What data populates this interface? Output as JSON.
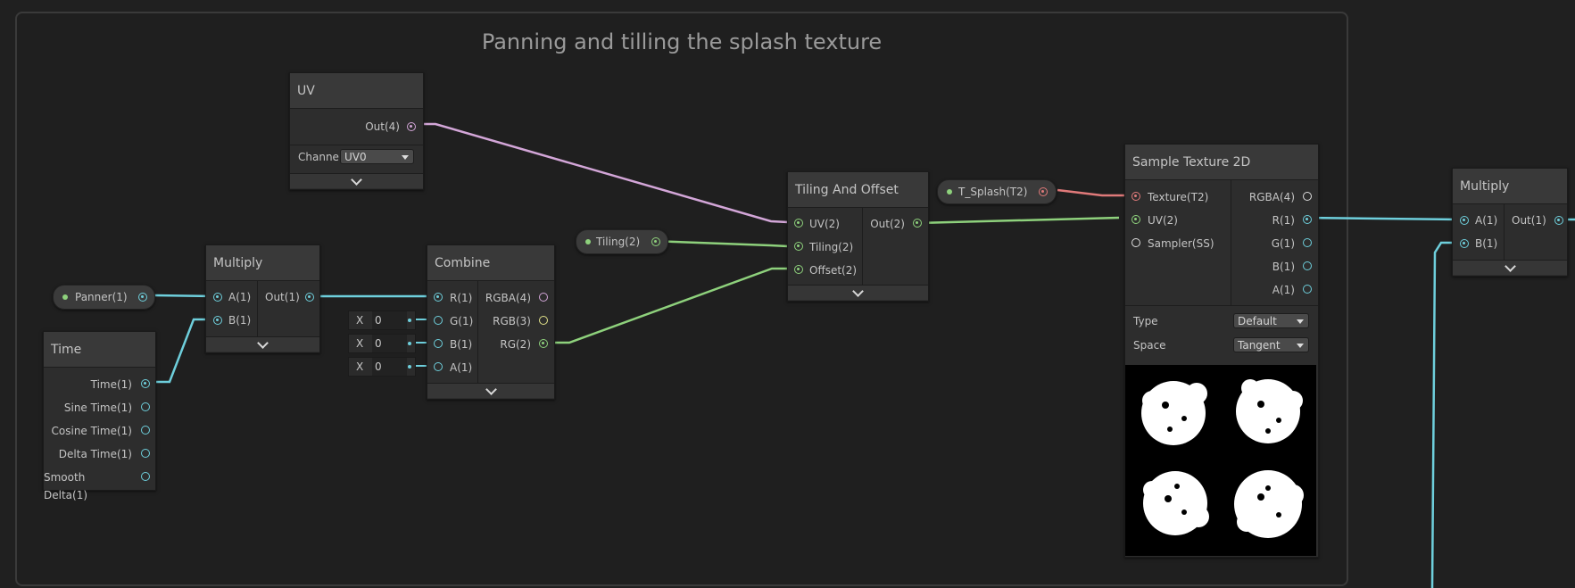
{
  "group": {
    "title": "Panning and tilling the splash texture"
  },
  "colors": {
    "background": "#202020",
    "wire_float": "#6ecfdc",
    "wire_vector2": "#8ed17c",
    "wire_vector4": "#d3a6d8",
    "wire_texture": "#e07a7a"
  },
  "nodes": {
    "uv": {
      "title": "UV",
      "out": "Out(4)",
      "channel_label": "Channe",
      "channel_value": "UV0"
    },
    "multiply1": {
      "title": "Multiply",
      "in_a": "A(1)",
      "in_b": "B(1)",
      "out": "Out(1)"
    },
    "time": {
      "title": "Time",
      "outputs": [
        "Time(1)",
        "Sine Time(1)",
        "Cosine Time(1)",
        "Delta Time(1)",
        "Smooth Delta(1)"
      ]
    },
    "combine": {
      "title": "Combine",
      "inputs": [
        "R(1)",
        "G(1)",
        "B(1)",
        "A(1)"
      ],
      "outputs": [
        "RGBA(4)",
        "RGB(3)",
        "RG(2)"
      ],
      "inline_label": "X",
      "inline_values": [
        "0",
        "0",
        "0"
      ]
    },
    "tiling_offset": {
      "title": "Tiling And Offset",
      "inputs": [
        "UV(2)",
        "Tiling(2)",
        "Offset(2)"
      ],
      "out": "Out(2)"
    },
    "sample_texture": {
      "title": "Sample Texture 2D",
      "inputs": [
        "Texture(T2)",
        "UV(2)",
        "Sampler(SS)"
      ],
      "outputs": [
        "RGBA(4)",
        "R(1)",
        "G(1)",
        "B(1)",
        "A(1)"
      ],
      "type_label": "Type",
      "type_value": "Default",
      "space_label": "Space",
      "space_value": "Tangent"
    },
    "multiply2": {
      "title": "Multiply",
      "in_a": "A(1)",
      "in_b": "B(1)",
      "out": "Out(1)"
    }
  },
  "properties": {
    "panner": "Panner(1)",
    "tiling": "Tiling(2)",
    "splash": "T_Splash(T2)"
  },
  "icons": {
    "collapse": "chevron-down-icon",
    "dropdown": "caret-down-icon"
  }
}
